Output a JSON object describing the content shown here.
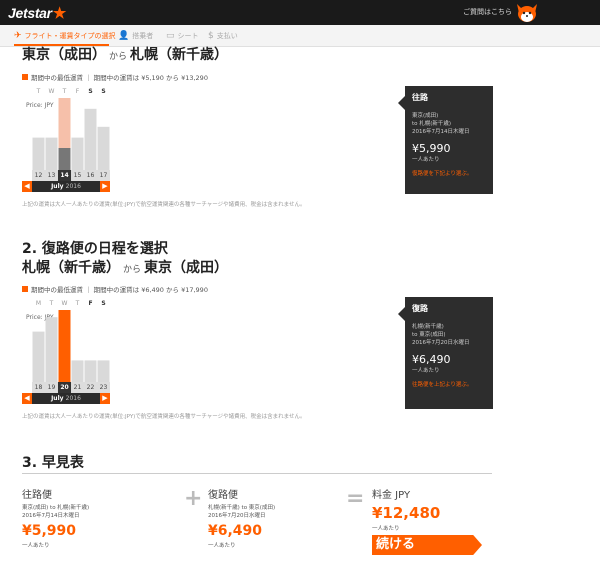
{
  "header": {
    "logo_text": "Jetstar",
    "help_text": "ご質問はこちら"
  },
  "progress": {
    "steps": [
      {
        "label": "フライト・運賃タイプの選択",
        "icon": "plane-icon"
      },
      {
        "label": "搭乗者",
        "icon": "person-icon"
      },
      {
        "label": "シート",
        "icon": "seat-icon"
      },
      {
        "label": "支払い",
        "icon": "dollar-icon"
      }
    ]
  },
  "outbound": {
    "route_from": "東京（成田）",
    "route_join": "から",
    "route_to": "札幌（新千歳）",
    "legend": "期間中の最低運賃 ｜ 期間中の運賃は ¥5,190 から ¥13,290",
    "currency": "Price: JPY",
    "month": "July",
    "year": "2016",
    "note": "上記の運賃は大人一人あたりの運賃(単位:JPY)で航空運賃関連の各種サーチャージや諸費用、税金は含まれません。"
  },
  "return": {
    "section_title": "2. 復路便の日程を選択",
    "route_from": "札幌（新千歳）",
    "route_join": "から",
    "route_to": "東京（成田）",
    "legend": "期間中の最低運賃 ｜ 期間中の運賃は ¥6,490 から ¥17,990",
    "currency": "Price: JPY",
    "month": "July",
    "year": "2016",
    "note": "上記の運賃は大人一人あたりの運賃(単位:JPY)で航空運賃関連の各種サーチャージや諸費用、税金は含まれません。"
  },
  "outbound_card": {
    "title": "往路",
    "from": "東京(成田)",
    "to": "to 札幌(新千歳)",
    "date": "2016年7月14日木曜日",
    "price": "¥5,990",
    "per": "一人あたり",
    "link": "復路便を下記より選ぶ。"
  },
  "return_card": {
    "title": "復路",
    "from": "札幌(新千歳)",
    "to": "to 東京(成田)",
    "date": "2016年7月20日水曜日",
    "price": "¥6,490",
    "per": "一人あたり",
    "link": "往路便を上記より選ぶ。"
  },
  "summary": {
    "title": "3. 早見表",
    "out_head": "往路便",
    "out_route": "東京(成田) to 札幌(新千歳)",
    "out_date": "2016年7月14日木曜日",
    "out_price": "¥5,990",
    "out_per": "一人あたり",
    "plus": "+",
    "ret_head": "復路便",
    "ret_route": "札幌(新千歳) to 東京(成田)",
    "ret_date": "2016年7月20日水曜日",
    "ret_price": "¥6,490",
    "ret_per": "一人あたり",
    "equals": "=",
    "total_head": "料金 JPY",
    "total_price": "¥12,480",
    "total_per": "一人あたり",
    "continue": "続ける"
  },
  "colors": {
    "accent": "#ff5f00",
    "bar_default": "#d9d9d9",
    "bar_light_accent": "#f6c0aa",
    "bar_selected": "#777777"
  },
  "chart_data": [
    {
      "type": "bar",
      "categories": [
        "12",
        "13",
        "14",
        "15",
        "16",
        "17"
      ],
      "day_labels": [
        "T",
        "W",
        "T",
        "F",
        "S",
        "S"
      ],
      "values": [
        0.45,
        0.45,
        1.0,
        0.45,
        0.85,
        0.6
      ],
      "highlight": [
        "none",
        "none",
        "lowest",
        "none",
        "none",
        "none"
      ],
      "selected": "14"
    },
    {
      "type": "bar",
      "categories": [
        "18",
        "19",
        "20",
        "21",
        "22",
        "23"
      ],
      "day_labels": [
        "M",
        "T",
        "W",
        "T",
        "F",
        "S"
      ],
      "values": [
        0.7,
        0.9,
        1.0,
        0.3,
        0.3,
        0.3
      ],
      "highlight": [
        "none",
        "none",
        "selected-lowest",
        "none",
        "none",
        "none"
      ],
      "selected": "20"
    }
  ]
}
